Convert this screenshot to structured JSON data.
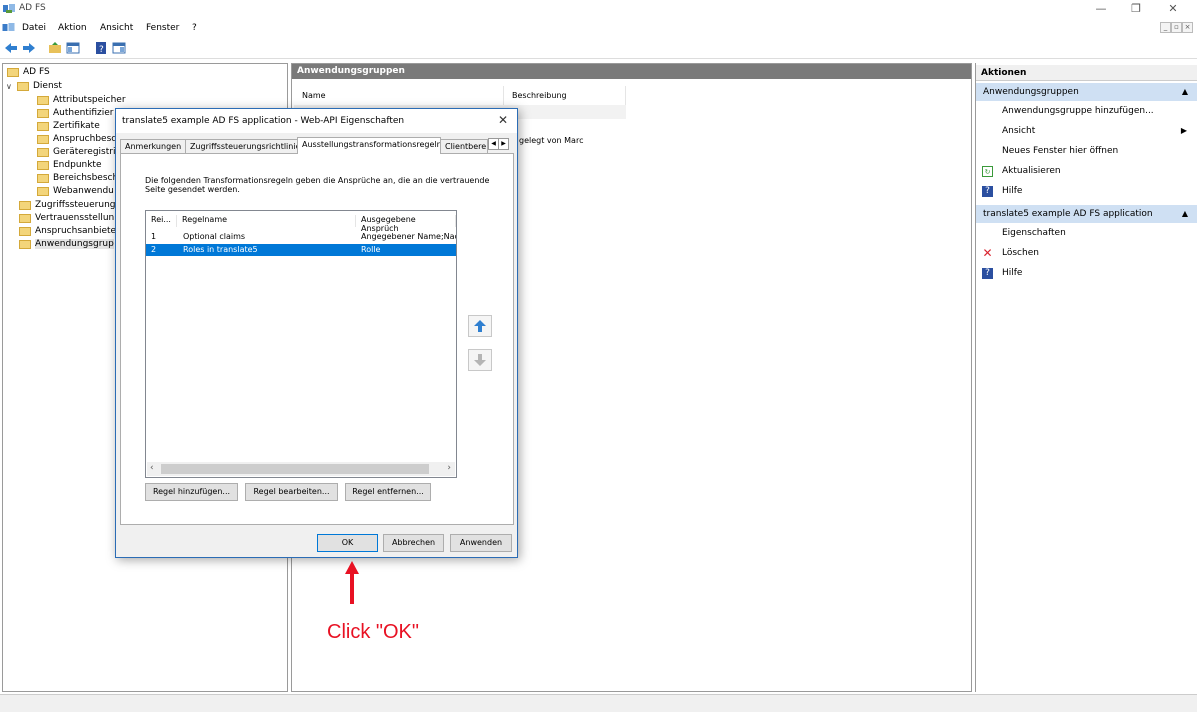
{
  "window": {
    "title": "AD FS"
  },
  "menu": {
    "items": [
      "Datei",
      "Aktion",
      "Ansicht",
      "Fenster",
      "?"
    ]
  },
  "tree": {
    "root": "AD FS",
    "service": "Dienst",
    "service_children": [
      "Attributspeicher",
      "Authentifizier",
      "Zertifikate",
      "Anspruchbesc",
      "Geräteregistrie",
      "Endpunkte",
      "Bereichsbesch",
      "Webanwendu"
    ],
    "top_items": [
      "Zugriffssteuerung",
      "Vertrauensstellun",
      "Anspruchsanbiete",
      "Anwendungsgrup"
    ]
  },
  "center": {
    "header": "Anwendungsgruppen",
    "columns": [
      "Name",
      "Beschreibung"
    ],
    "row_fragment": "gelegt von Marc"
  },
  "actions": {
    "header": "Aktionen",
    "section1": "Anwendungsgruppen",
    "section1_items": [
      "Anwendungsgruppe hinzufügen...",
      "Ansicht",
      "Neues Fenster hier öffnen",
      "Aktualisieren",
      "Hilfe"
    ],
    "section2": "translate5 example AD FS application",
    "section2_items": [
      "Eigenschaften",
      "Löschen",
      "Hilfe"
    ]
  },
  "dialog": {
    "title": "translate5 example AD FS application - Web-API Eigenschaften",
    "tabs": [
      "Anmerkungen",
      "Zugriffssteuerungsrichtlinie",
      "Ausstellungstransformationsregeln",
      "Clientbereic"
    ],
    "intro": "Die folgenden Transformationsregeln geben die Ansprüche an, die an die vertrauende Seite gesendet werden.",
    "list_headers": [
      "Rei...",
      "Regelname",
      "Ausgegebene Ansprüch"
    ],
    "rules": [
      {
        "order": "1",
        "name": "Optional claims",
        "claims": "Angegebener Name;Nac"
      },
      {
        "order": "2",
        "name": "Roles in translate5",
        "claims": "Rolle"
      }
    ],
    "rule_buttons": [
      "Regel hinzufügen...",
      "Regel bearbeiten...",
      "Regel entfernen..."
    ],
    "footer_buttons": [
      "OK",
      "Abbrechen",
      "Anwenden"
    ]
  },
  "annotation": {
    "text": "Click \"OK\"",
    "color": "#e81123"
  }
}
